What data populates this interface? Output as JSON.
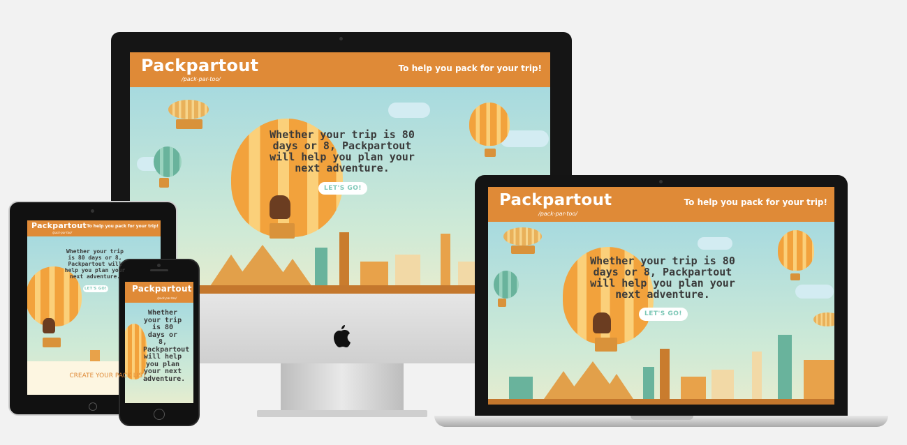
{
  "site": {
    "brand": "Packpartout",
    "pronunciation": "/pack-par-too/",
    "tagline": "To help you pack for your trip!",
    "hero_text": "Whether your trip is 80 days or 8, Packpartout will help you plan your next adventure.",
    "cta_label": "LET'S GO!",
    "section_heading": "CREATE YOUR PACK LIST"
  },
  "colors": {
    "header_orange": "#df8a37",
    "sky": "#a7dadf",
    "button_text": "#7cc7b6",
    "background": "#f2f2f2"
  },
  "icons": [
    "apple-logo-icon",
    "camera-icon",
    "home-button-icon"
  ]
}
